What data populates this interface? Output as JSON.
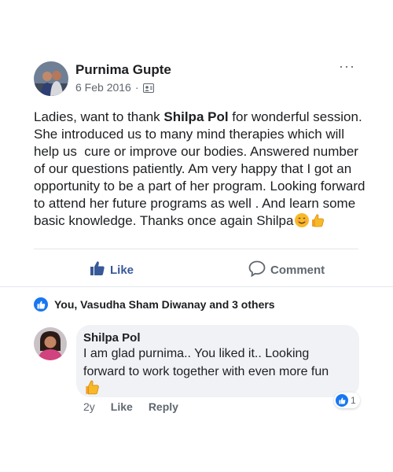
{
  "post": {
    "author": "Purnima Gupte",
    "date": "6 Feb 2016",
    "separator": "·",
    "more_label": "···",
    "text_before": "Ladies, want to thank ",
    "text_bold": "Shilpa Pol",
    "text_after": " for wonderful session. She introduced us to many mind therapies which will help us  cure or improve our bodies. Answered number of our questions patiently. Am very happy that I got an opportunity to be a part of her program. Looking forward to attend her future programs as well . And learn some basic knowledge. Thanks once again Shilpa",
    "icons": [
      "smile-emoji-icon",
      "thumbs-up-emoji-icon"
    ]
  },
  "actions": {
    "like_label": "Like",
    "comment_label": "Comment"
  },
  "reactions": {
    "summary": "You, Vasudha Sham Diwanay and 3 others"
  },
  "comment": {
    "author": "Shilpa Pol",
    "text": "I am glad purnima.. You liked it.. Looking forward to work together with even more fun",
    "time": "2y",
    "like_label": "Like",
    "reply_label": "Reply",
    "reaction_count": "1"
  },
  "colors": {
    "accent": "#385898",
    "like_badge": "#1877f2",
    "bubble": "#f0f2f5",
    "emoji": "#f7b928"
  }
}
